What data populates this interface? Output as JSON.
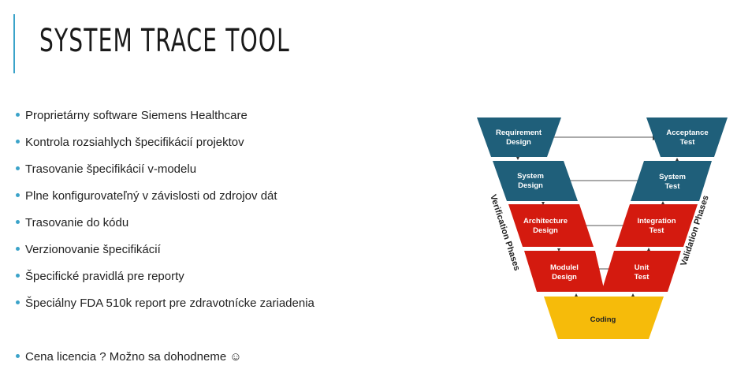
{
  "slide": {
    "title": "SYSTEM TRACE TOOL",
    "accent_color": "#3ba3c9"
  },
  "bullets": [
    "Proprietárny software Siemens Healthcare",
    "Kontrola rozsiahlych špecifikácií projektov",
    "Trasovanie špecifikácií v-modelu",
    "Plne konfigurovateľný v závislosti od zdrojov dát",
    "Trasovanie do kódu",
    "Verzionovanie špecifikácií",
    "Špecifické pravidlá pre reporty",
    "Špeciálny FDA 510k report pre zdravotnícke zariadenia",
    "Cena licencia ? Možno sa dohodneme ☺"
  ],
  "v_model": {
    "colors": {
      "blue": "#1f5f7a",
      "red": "#d41a0f",
      "yellow": "#f6bb0a"
    },
    "left": {
      "requirement": [
        "Requirement",
        "Design"
      ],
      "system": [
        "System",
        "Design"
      ],
      "architecture": [
        "Architecture",
        "Design"
      ],
      "module": [
        "Modulel",
        "Design"
      ]
    },
    "right": {
      "acceptance": [
        "Acceptance",
        "Test"
      ],
      "system": [
        "System",
        "Test"
      ],
      "integration": [
        "Integration",
        "Test"
      ],
      "unit": [
        "Unit",
        "Test"
      ]
    },
    "coding": "Coding",
    "verification_label": "Verification Phases",
    "validation_label": "Validation Phases"
  }
}
